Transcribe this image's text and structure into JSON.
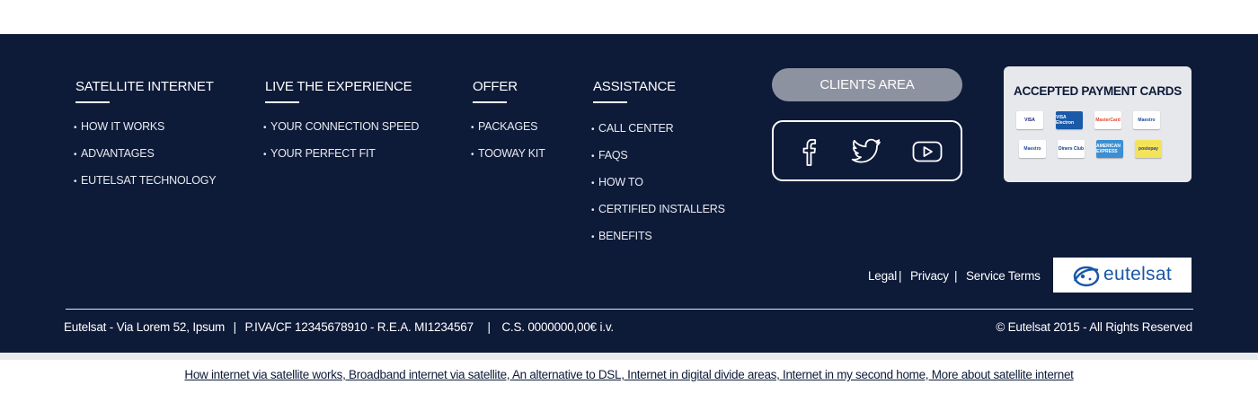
{
  "columns": [
    {
      "title": "SATELLITE INTERNET",
      "items": [
        "HOW IT WORKS",
        "ADVANTAGES",
        "EUTELSAT TECHNOLOGY"
      ]
    },
    {
      "title": "LIVE THE EXPERIENCE",
      "items": [
        "YOUR CONNECTION SPEED",
        "YOUR PERFECT FIT"
      ]
    },
    {
      "title": "OFFER",
      "items": [
        "PACKAGES",
        "TOOWAY KIT"
      ]
    },
    {
      "title": "ASSISTANCE",
      "items": [
        "CALL CENTER",
        "FAQS",
        "HOW TO",
        "CERTIFIED INSTALLERS",
        "BENEFITS"
      ]
    }
  ],
  "bullet": "•",
  "clients_area": {
    "label": "CLIENTS AREA"
  },
  "social": {
    "icons": [
      "facebook-icon",
      "twitter-icon",
      "youtube-icon"
    ]
  },
  "payment": {
    "title": "ACCEPTED PAYMENT CARDS",
    "cards": [
      {
        "name": "visa",
        "text": "VISA",
        "bg": "#ffffff",
        "color": "#1a1f71"
      },
      {
        "name": "visa-electron",
        "text": "VISA Electron",
        "bg": "#1a5aa8",
        "color": "#ffffff"
      },
      {
        "name": "mastercard",
        "text": "MasterCard",
        "bg": "#ffffff",
        "color": "#e8432f"
      },
      {
        "name": "maestro",
        "text": "Maestro",
        "bg": "#ffffff",
        "color": "#1c4ea0"
      },
      {
        "name": "maestro-2",
        "text": "Maestro",
        "bg": "#ffffff",
        "color": "#1c4ea0"
      },
      {
        "name": "diners-club",
        "text": "Diners Club",
        "bg": "#ffffff",
        "color": "#0b3c7e"
      },
      {
        "name": "american-express",
        "text": "AMERICAN EXPRESS",
        "bg": "#3c8fd2",
        "color": "#ffffff"
      },
      {
        "name": "postepay",
        "text": "postepay",
        "bg": "#f3e35a",
        "color": "#2a3b8f"
      }
    ]
  },
  "legal": {
    "legal": "Legal",
    "privacy": "Privacy",
    "service_terms": "Service Terms",
    "separator": "|"
  },
  "logo": {
    "text": "eutelsat"
  },
  "company_info": {
    "address": "Eutelsat - Via Lorem 52, Ipsum",
    "vat": "P.IVA/CF 12345678910 - R.E.A. MI1234567",
    "capital": "C.S. 0000000,00€ i.v.",
    "separator": "|"
  },
  "copyright": "© Eutelsat 2015 - All Rights Reserved",
  "bottom_links": "How internet via satellite works, Broadband internet via satellite, An alternative to DSL, Internet in digital divide areas, Internet in my second home, More about satellite internet",
  "colors": {
    "footer_bg": "#0d1a38",
    "button_gray": "#8d92a0",
    "payment_bg": "#e7e8ec",
    "logo_blue": "#1a57a8"
  }
}
